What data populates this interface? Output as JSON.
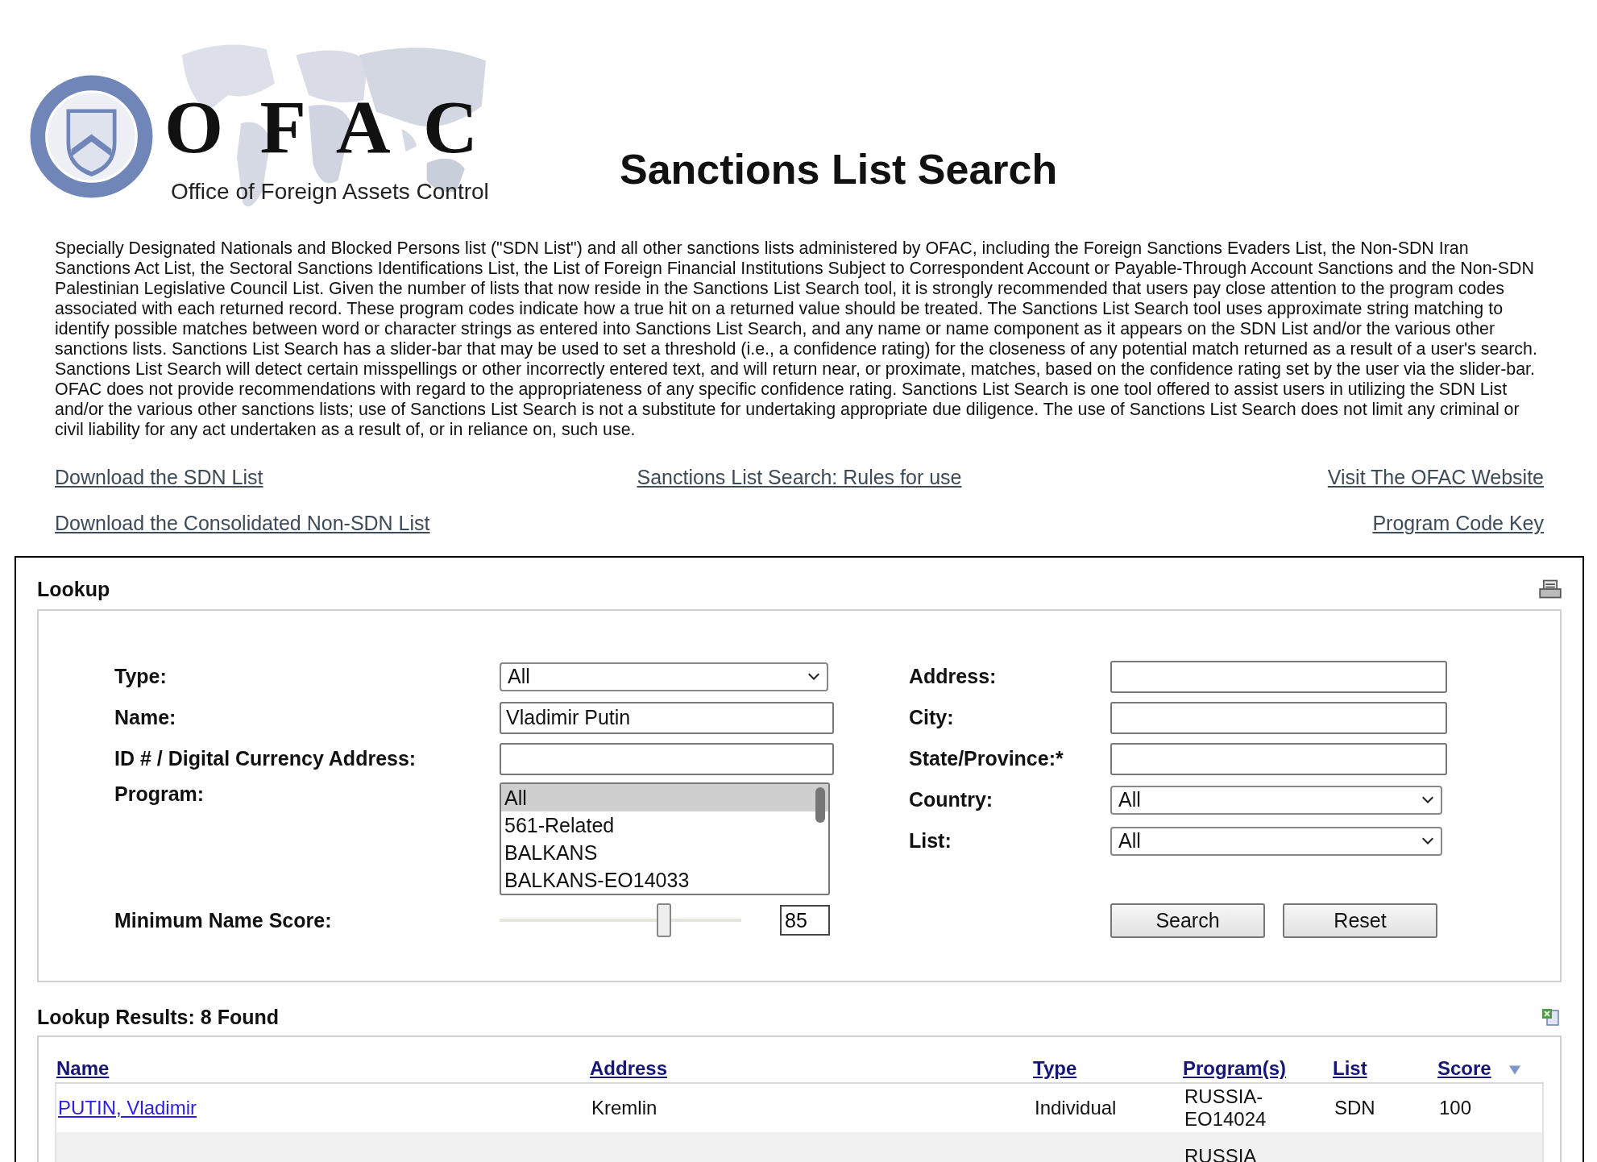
{
  "logo": {
    "letters": "O F A C",
    "subtitle": "Office of Foreign Assets Control"
  },
  "title": "Sanctions List Search",
  "intro": "Specially Designated Nationals and Blocked Persons list (\"SDN List\") and all other sanctions lists administered by OFAC, including the Foreign Sanctions Evaders List, the Non-SDN Iran Sanctions Act List, the Sectoral Sanctions Identifications List, the List of Foreign Financial Institutions Subject to Correspondent Account or Payable-Through Account Sanctions and the Non-SDN Palestinian Legislative Council List. Given the number of lists that now reside in the Sanctions List Search tool, it is strongly recommended that users pay close attention to the program codes associated with each returned record. These program codes indicate how a true hit on a returned value should be treated. The Sanctions List Search tool uses approximate string matching to identify possible matches between word or character strings as entered into Sanctions List Search, and any name or name component as it appears on the SDN List and/or the various other sanctions lists. Sanctions List Search has a slider-bar that may be used to set a threshold (i.e., a confidence rating) for the closeness of any potential match returned as a result of a user's search. Sanctions List Search will detect certain misspellings or other incorrectly entered text, and will return near, or proximate, matches, based on the confidence rating set by the user via the slider-bar. OFAC does not provide recommendations with regard to the appropriateness of any specific confidence rating. Sanctions List Search is one tool offered to assist users in utilizing the SDN List and/or the various other sanctions lists; use of Sanctions List Search is not a substitute for undertaking appropriate due diligence. The use of Sanctions List Search does not limit any criminal or civil liability for any act undertaken as a result of, or in reliance on, such use.",
  "links": [
    [
      {
        "label": "Download the SDN List",
        "kind": "left"
      },
      {
        "label": "Sanctions List Search: Rules for use",
        "kind": "center"
      },
      {
        "label": "Visit The OFAC Website",
        "kind": "right"
      }
    ],
    [
      {
        "label": "Download the Consolidated Non-SDN List",
        "kind": "left"
      },
      {
        "label": "Program Code Key",
        "kind": "right"
      }
    ]
  ],
  "lookup": {
    "title": "Lookup",
    "type": {
      "label": "Type:",
      "value": "All"
    },
    "name": {
      "label": "Name:",
      "value": "Vladimir Putin"
    },
    "id": {
      "label": "ID # / Digital Currency Address:"
    },
    "program": {
      "label": "Program:",
      "options": [
        {
          "label": "All",
          "selected": true
        },
        {
          "label": "561-Related",
          "selected": false
        },
        {
          "label": "BALKANS",
          "selected": false
        },
        {
          "label": "BALKANS-EO14033",
          "selected": false
        }
      ]
    },
    "score": {
      "label": "Minimum Name Score:",
      "level": 0.68,
      "value": "85"
    },
    "address": {
      "label": "Address:"
    },
    "city": {
      "label": "City:"
    },
    "state": {
      "label": "State/Province:*"
    },
    "country": {
      "label": "Country:",
      "value": "All"
    },
    "list": {
      "label": "List:",
      "value": "All"
    },
    "buttons": [
      "Search",
      "Reset"
    ]
  },
  "results": {
    "title": "Lookup Results: 8 Found",
    "columns": [
      "Name",
      "Address",
      "Type",
      "Program(s)",
      "List",
      "Score"
    ],
    "rows": [
      {
        "name": "PUTIN, Vladimir",
        "address": "Kremlin",
        "type": "Individual",
        "program": "RUSSIA-EO14024",
        "list": "SDN",
        "score": "100"
      },
      {
        "program": "RUSSIA"
      }
    ]
  }
}
